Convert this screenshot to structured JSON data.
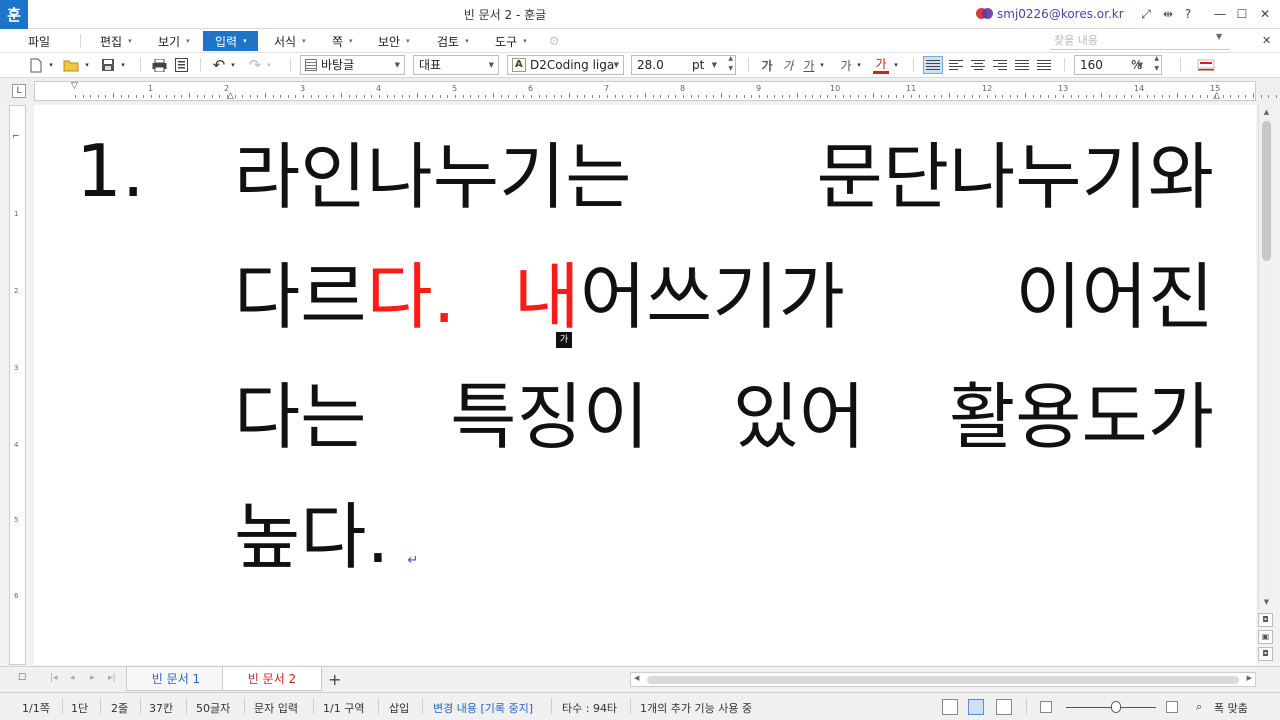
{
  "titlebar": {
    "app_logo": "훈",
    "title": "빈 문서 2 - 훈글",
    "account_email": "smj0226@kores.or.kr",
    "buttons": [
      "fullscreen-icon",
      "split-icon",
      "help-icon",
      "minimize-icon",
      "maximize-icon",
      "close-icon"
    ]
  },
  "menubar": {
    "items": [
      {
        "label": "파일",
        "arrow": ""
      },
      {
        "label": "편집",
        "arrow": "▾"
      },
      {
        "label": "보기",
        "arrow": "▾"
      },
      {
        "label": "입력",
        "arrow": "▾"
      },
      {
        "label": "서식",
        "arrow": "▾"
      },
      {
        "label": "쪽",
        "arrow": "▾"
      },
      {
        "label": "보안",
        "arrow": "▾"
      },
      {
        "label": "검토",
        "arrow": "▾"
      },
      {
        "label": "도구",
        "arrow": "▾"
      }
    ],
    "active_index": 3,
    "find_placeholder": "찾을 내용"
  },
  "toolbar": {
    "style": "바탕글",
    "font_category": "대표",
    "font_name": "D2Coding liga",
    "font_size": "28.0",
    "font_unit": "pt",
    "format_buttons": [
      "가",
      "가",
      "가",
      "가",
      "가"
    ],
    "line_spacing": "160",
    "line_spacing_unit": "%",
    "accent_color": "#d42020"
  },
  "ruler": {
    "numbers": [
      "1",
      "2",
      "3",
      "4",
      "5",
      "6",
      "7",
      "8",
      "9",
      "10",
      "11",
      "12",
      "13",
      "14",
      "15"
    ],
    "vnumbers": [
      "1",
      "2",
      "3",
      "4",
      "5",
      "6"
    ]
  },
  "document": {
    "list_number": "1.",
    "lines": [
      {
        "parts": [
          {
            "text": "라인나누기는",
            "color": ""
          },
          {
            "text": "문단나누기와",
            "color": ""
          }
        ]
      },
      {
        "parts": [
          {
            "text": "다르",
            "color": ""
          },
          {
            "text": "다.",
            "color": "#ff1a1a"
          },
          {
            "text": "내",
            "color": "#ff1a1a"
          },
          {
            "text": "어쓰기가",
            "color": ""
          },
          {
            "text": "이어진",
            "color": ""
          }
        ]
      },
      {
        "parts": [
          {
            "text": "다는",
            "color": ""
          },
          {
            "text": "특징이",
            "color": ""
          },
          {
            "text": "있어",
            "color": ""
          },
          {
            "text": "활용도가",
            "color": ""
          }
        ]
      },
      {
        "parts": [
          {
            "text": "높다.",
            "color": ""
          }
        ]
      }
    ],
    "paragraph_mark": "↵",
    "ime_indicator": "가"
  },
  "tabs": {
    "items": [
      {
        "label": "빈 문서 1",
        "active": false
      },
      {
        "label": "빈 문서 2",
        "active": true
      }
    ],
    "add_label": "+"
  },
  "statusbar": {
    "page": "1/1쪽",
    "column": "1단",
    "line": "2줄",
    "col_pos": "37칸",
    "chars": "50글자",
    "input_mode": "문자 입력",
    "section": "1/1 구역",
    "insert_mode": "삽입",
    "track_changes": "변경 내용 [기록 중지]",
    "keystrokes": "타수 : 94타",
    "addon_status": "1개의 추가 기능 사용 중",
    "zoom_label": "폭 맞춤",
    "zoom_level": 0.55
  }
}
